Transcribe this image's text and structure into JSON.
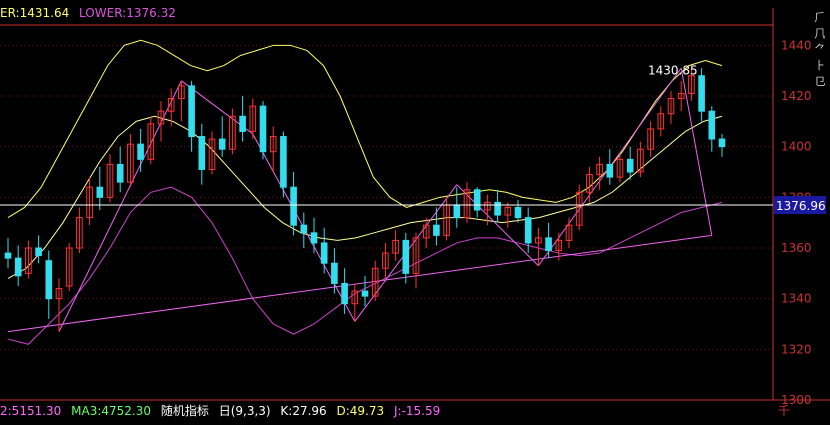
{
  "header": {
    "upper_label": "ER:1431.64",
    "lower_label": "LOWER:1376.32",
    "upper_color": "#ffff66",
    "lower_color": "#dd55dd"
  },
  "footer": {
    "ma2": "2:5151.30",
    "ma3": "MA3:4752.30",
    "indicator_name": "随机指标",
    "params": "⽇(9,3,3)",
    "k": "K:27.96",
    "d": "D:49.73",
    "j": "J:-15.59",
    "right_glyph": "千"
  },
  "right_panel": {
    "glyphs": [
      "⺁",
      "⺇",
      "⺈",
      "⺊",
      "⺋"
    ],
    "glyph_icon": "side-toolbar-icons"
  },
  "colors": {
    "bull": "#ff3333",
    "bear": "#33ddee",
    "upper_band": "#ffff66",
    "mid_band": "#ffff99",
    "lower_band": "#cc44cc",
    "trendline": "#ee66ee",
    "price_line": "#ffffff",
    "axis": "#c83232",
    "price_tag_bg": "#1a1aa0"
  },
  "chart_data": {
    "type": "candlestick",
    "ylim": [
      1300,
      1450
    ],
    "yticks": [
      1300,
      1320,
      1340,
      1360,
      1380,
      1400,
      1420,
      1440
    ],
    "grid": true,
    "current_price": 1376.96,
    "current_price_label": "1376.96",
    "high_annotation": {
      "value": 1430.85,
      "label": "1430.85"
    },
    "candles": [
      {
        "o": 1358,
        "h": 1364,
        "l": 1352,
        "c": 1356
      },
      {
        "o": 1356,
        "h": 1361,
        "l": 1345,
        "c": 1349
      },
      {
        "o": 1350,
        "h": 1363,
        "l": 1348,
        "c": 1360
      },
      {
        "o": 1360,
        "h": 1365,
        "l": 1354,
        "c": 1357
      },
      {
        "o": 1355,
        "h": 1359,
        "l": 1332,
        "c": 1340
      },
      {
        "o": 1340,
        "h": 1348,
        "l": 1327,
        "c": 1344
      },
      {
        "o": 1345,
        "h": 1362,
        "l": 1343,
        "c": 1360
      },
      {
        "o": 1360,
        "h": 1376,
        "l": 1358,
        "c": 1372
      },
      {
        "o": 1372,
        "h": 1388,
        "l": 1369,
        "c": 1384
      },
      {
        "o": 1384,
        "h": 1392,
        "l": 1375,
        "c": 1380
      },
      {
        "o": 1380,
        "h": 1397,
        "l": 1378,
        "c": 1393
      },
      {
        "o": 1393,
        "h": 1400,
        "l": 1382,
        "c": 1386
      },
      {
        "o": 1386,
        "h": 1405,
        "l": 1384,
        "c": 1401
      },
      {
        "o": 1401,
        "h": 1407,
        "l": 1390,
        "c": 1395
      },
      {
        "o": 1395,
        "h": 1412,
        "l": 1393,
        "c": 1409
      },
      {
        "o": 1409,
        "h": 1418,
        "l": 1402,
        "c": 1414
      },
      {
        "o": 1414,
        "h": 1423,
        "l": 1408,
        "c": 1419
      },
      {
        "o": 1419,
        "h": 1426,
        "l": 1410,
        "c": 1424
      },
      {
        "o": 1424,
        "h": 1426,
        "l": 1398,
        "c": 1404
      },
      {
        "o": 1404,
        "h": 1409,
        "l": 1385,
        "c": 1391
      },
      {
        "o": 1391,
        "h": 1406,
        "l": 1389,
        "c": 1403
      },
      {
        "o": 1403,
        "h": 1412,
        "l": 1396,
        "c": 1399
      },
      {
        "o": 1399,
        "h": 1415,
        "l": 1397,
        "c": 1412
      },
      {
        "o": 1412,
        "h": 1420,
        "l": 1402,
        "c": 1406
      },
      {
        "o": 1406,
        "h": 1419,
        "l": 1403,
        "c": 1416
      },
      {
        "o": 1416,
        "h": 1418,
        "l": 1395,
        "c": 1398
      },
      {
        "o": 1398,
        "h": 1408,
        "l": 1390,
        "c": 1404
      },
      {
        "o": 1404,
        "h": 1406,
        "l": 1380,
        "c": 1384
      },
      {
        "o": 1384,
        "h": 1390,
        "l": 1365,
        "c": 1369
      },
      {
        "o": 1369,
        "h": 1374,
        "l": 1360,
        "c": 1366
      },
      {
        "o": 1366,
        "h": 1372,
        "l": 1358,
        "c": 1362
      },
      {
        "o": 1362,
        "h": 1368,
        "l": 1350,
        "c": 1354
      },
      {
        "o": 1354,
        "h": 1360,
        "l": 1342,
        "c": 1346
      },
      {
        "o": 1346,
        "h": 1352,
        "l": 1334,
        "c": 1338
      },
      {
        "o": 1338,
        "h": 1346,
        "l": 1331,
        "c": 1343
      },
      {
        "o": 1343,
        "h": 1349,
        "l": 1337,
        "c": 1341
      },
      {
        "o": 1341,
        "h": 1355,
        "l": 1339,
        "c": 1352
      },
      {
        "o": 1352,
        "h": 1362,
        "l": 1348,
        "c": 1358
      },
      {
        "o": 1358,
        "h": 1367,
        "l": 1355,
        "c": 1363
      },
      {
        "o": 1363,
        "h": 1366,
        "l": 1346,
        "c": 1350
      },
      {
        "o": 1350,
        "h": 1366,
        "l": 1344,
        "c": 1364
      },
      {
        "o": 1364,
        "h": 1372,
        "l": 1360,
        "c": 1369
      },
      {
        "o": 1369,
        "h": 1376,
        "l": 1361,
        "c": 1365
      },
      {
        "o": 1365,
        "h": 1380,
        "l": 1363,
        "c": 1377
      },
      {
        "o": 1377,
        "h": 1384,
        "l": 1368,
        "c": 1372
      },
      {
        "o": 1372,
        "h": 1386,
        "l": 1370,
        "c": 1383
      },
      {
        "o": 1383,
        "h": 1384,
        "l": 1372,
        "c": 1375
      },
      {
        "o": 1375,
        "h": 1381,
        "l": 1369,
        "c": 1378
      },
      {
        "o": 1378,
        "h": 1383,
        "l": 1370,
        "c": 1373
      },
      {
        "o": 1373,
        "h": 1378,
        "l": 1368,
        "c": 1376
      },
      {
        "o": 1376,
        "h": 1379,
        "l": 1370,
        "c": 1372
      },
      {
        "o": 1372,
        "h": 1376,
        "l": 1358,
        "c": 1362
      },
      {
        "o": 1362,
        "h": 1368,
        "l": 1353,
        "c": 1364
      },
      {
        "o": 1364,
        "h": 1370,
        "l": 1356,
        "c": 1359
      },
      {
        "o": 1359,
        "h": 1366,
        "l": 1355,
        "c": 1363
      },
      {
        "o": 1363,
        "h": 1372,
        "l": 1360,
        "c": 1369
      },
      {
        "o": 1369,
        "h": 1385,
        "l": 1367,
        "c": 1382
      },
      {
        "o": 1382,
        "h": 1392,
        "l": 1378,
        "c": 1389
      },
      {
        "o": 1389,
        "h": 1396,
        "l": 1383,
        "c": 1393
      },
      {
        "o": 1393,
        "h": 1399,
        "l": 1385,
        "c": 1388
      },
      {
        "o": 1388,
        "h": 1397,
        "l": 1386,
        "c": 1395
      },
      {
        "o": 1395,
        "h": 1400,
        "l": 1387,
        "c": 1390
      },
      {
        "o": 1390,
        "h": 1402,
        "l": 1388,
        "c": 1399
      },
      {
        "o": 1399,
        "h": 1410,
        "l": 1396,
        "c": 1407
      },
      {
        "o": 1407,
        "h": 1416,
        "l": 1404,
        "c": 1413
      },
      {
        "o": 1413,
        "h": 1422,
        "l": 1409,
        "c": 1419
      },
      {
        "o": 1419,
        "h": 1426,
        "l": 1414,
        "c": 1421
      },
      {
        "o": 1421,
        "h": 1431,
        "l": 1418,
        "c": 1428
      },
      {
        "o": 1428,
        "h": 1431,
        "l": 1410,
        "c": 1414
      },
      {
        "o": 1414,
        "h": 1416,
        "l": 1398,
        "c": 1403
      },
      {
        "o": 1403,
        "h": 1405,
        "l": 1396,
        "c": 1400
      }
    ],
    "upper_band": [
      1372,
      1376,
      1384,
      1396,
      1408,
      1420,
      1432,
      1440,
      1442,
      1440,
      1436,
      1432,
      1430,
      1432,
      1436,
      1438,
      1440,
      1440,
      1438,
      1432,
      1420,
      1404,
      1388,
      1380,
      1376,
      1378,
      1380,
      1381,
      1382,
      1383,
      1382,
      1380,
      1379,
      1378,
      1380,
      1384,
      1390,
      1398,
      1408,
      1418,
      1426,
      1432,
      1434,
      1432
    ],
    "mid_band": [
      1348,
      1352,
      1360,
      1370,
      1382,
      1394,
      1404,
      1410,
      1412,
      1410,
      1406,
      1400,
      1392,
      1384,
      1376,
      1370,
      1366,
      1364,
      1363,
      1364,
      1366,
      1368,
      1370,
      1371,
      1372,
      1372,
      1371,
      1370,
      1371,
      1372,
      1374,
      1376,
      1378,
      1382,
      1388,
      1394,
      1400,
      1406,
      1410,
      1412
    ],
    "lower_band": [
      1324,
      1322,
      1330,
      1338,
      1348,
      1360,
      1374,
      1382,
      1384,
      1380,
      1370,
      1356,
      1340,
      1330,
      1326,
      1330,
      1336,
      1342,
      1346,
      1350,
      1354,
      1358,
      1362,
      1364,
      1364,
      1362,
      1360,
      1358,
      1357,
      1358,
      1362,
      1366,
      1370,
      1374,
      1376,
      1378
    ],
    "trend_lines": [
      {
        "from": [
          0,
          1327
        ],
        "to": [
          69,
          1365
        ],
        "name": "support-trendline"
      },
      {
        "from": [
          5,
          1327
        ],
        "to": [
          17,
          1426
        ],
        "name": "wave-line-1"
      },
      {
        "from": [
          17,
          1426
        ],
        "to": [
          24,
          1405
        ],
        "name": "wave-line-2"
      },
      {
        "from": [
          24,
          1405
        ],
        "to": [
          34,
          1331
        ],
        "name": "wave-line-3"
      },
      {
        "from": [
          34,
          1331
        ],
        "to": [
          44,
          1385
        ],
        "name": "wave-line-4"
      },
      {
        "from": [
          44,
          1385
        ],
        "to": [
          52,
          1353
        ],
        "name": "wave-line-5"
      },
      {
        "from": [
          52,
          1353
        ],
        "to": [
          66,
          1431
        ],
        "name": "wave-line-6"
      },
      {
        "from": [
          66,
          1431
        ],
        "to": [
          69,
          1365
        ],
        "name": "wave-line-7"
      }
    ]
  }
}
